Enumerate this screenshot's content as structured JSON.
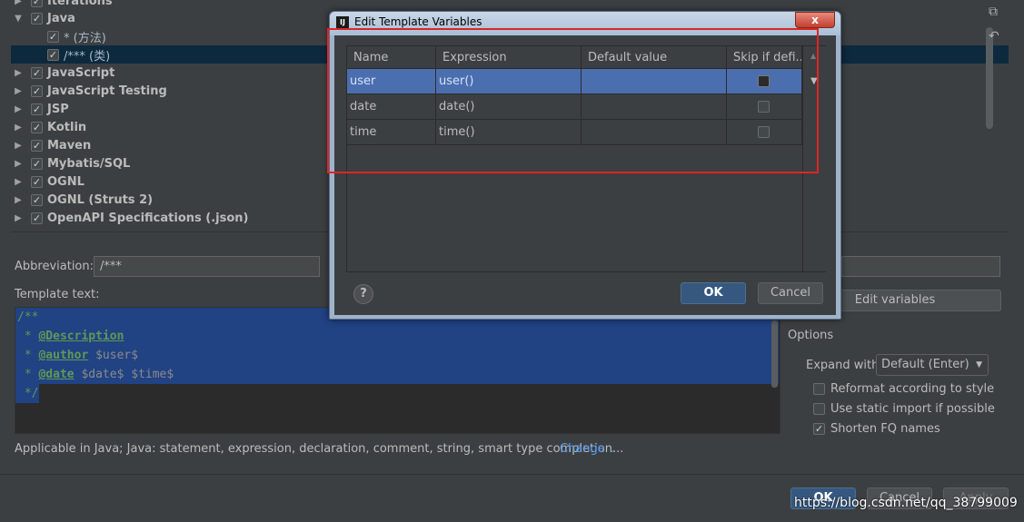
{
  "tree": {
    "items": [
      {
        "label": "Iterations",
        "expanded": false,
        "checked": true
      },
      {
        "label": "Java",
        "expanded": true,
        "checked": true
      },
      {
        "label": "* (方法)",
        "child": true,
        "checked": true
      },
      {
        "label": "/*** (类)",
        "child": true,
        "checked": true,
        "selected": true
      },
      {
        "label": "JavaScript",
        "expanded": false,
        "checked": true
      },
      {
        "label": "JavaScript Testing",
        "expanded": false,
        "checked": true
      },
      {
        "label": "JSP",
        "expanded": false,
        "checked": true
      },
      {
        "label": "Kotlin",
        "expanded": false,
        "checked": true
      },
      {
        "label": "Maven",
        "expanded": false,
        "checked": true
      },
      {
        "label": "Mybatis/SQL",
        "expanded": false,
        "checked": true
      },
      {
        "label": "OGNL",
        "expanded": false,
        "checked": true
      },
      {
        "label": "OGNL (Struts 2)",
        "expanded": false,
        "checked": true
      },
      {
        "label": "OpenAPI Specifications (.json)",
        "expanded": false,
        "checked": true
      }
    ],
    "icons": {
      "copy": "copy-icon",
      "revert": "revert-icon"
    }
  },
  "abbreviation": {
    "label": "Abbreviation:",
    "value": "/***"
  },
  "template": {
    "label": "Template text:",
    "lines": {
      "l1": "/**",
      "l2_prefix": " * ",
      "l2_tag": "@Description",
      "l3_prefix": " * ",
      "l3_tag": "@author",
      "l3_var": " $user$",
      "l4_prefix": " * ",
      "l4_tag": "@date",
      "l4_var": " $date$ $time$",
      "l5": " */"
    }
  },
  "edit_variables_label": "Edit variables",
  "applicable": {
    "text": "Applicable in Java; Java: statement, expression, declaration, comment, string, smart type completion...",
    "change": "Change"
  },
  "options": {
    "title": "Options",
    "expand_with_label": "Expand with",
    "expand_with_value": "Default (Enter)",
    "reformat": {
      "label": "Reformat according to style",
      "checked": false
    },
    "static_import": {
      "label": "Use static import if possible",
      "checked": false
    },
    "shorten_fq": {
      "label": "Shorten FQ names",
      "checked": true
    }
  },
  "footer": {
    "ok": "OK",
    "cancel": "Cancel",
    "apply": "Apply"
  },
  "dialog": {
    "title": "Edit Template Variables",
    "app_icon": "IJ",
    "close": "x",
    "columns": [
      "Name",
      "Expression",
      "Default value",
      "Skip if defi..."
    ],
    "rows": [
      {
        "name": "user",
        "expression": "user()",
        "default": "",
        "skip": false,
        "selected": true
      },
      {
        "name": "date",
        "expression": "date()",
        "default": "",
        "skip": false
      },
      {
        "name": "time",
        "expression": "time()",
        "default": "",
        "skip": false
      }
    ],
    "help": "?",
    "ok": "OK",
    "cancel": "Cancel"
  },
  "watermark": "https://blog.csdn.net/qq_38799009",
  "colors": {
    "accent": "#365880",
    "selection": "#4b6eaf",
    "highlight_box": "#e02424"
  }
}
